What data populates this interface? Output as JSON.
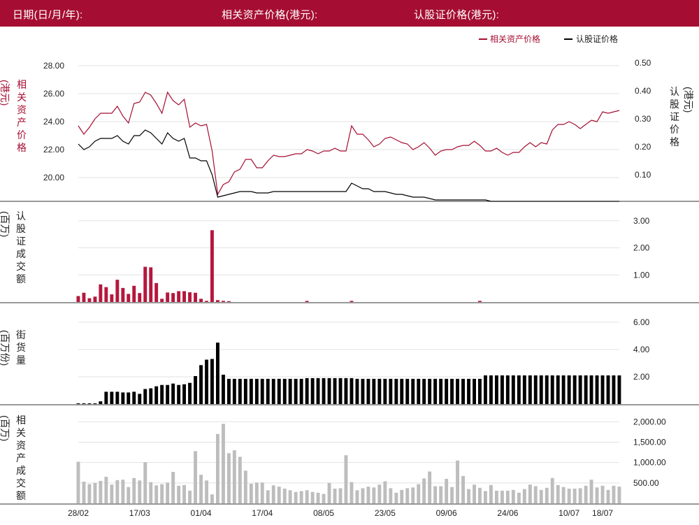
{
  "header": {
    "date_label": "日期(日/月/年):",
    "underlying_label": "相关资产价格(港元):",
    "warrant_label": "认股证价格(港元):"
  },
  "colors": {
    "brand": "#a50e32",
    "underlying": "#a50e32",
    "warrant": "#000000",
    "warrant_volume": "#b5173d",
    "outstanding": "#000000",
    "underlying_turnover": "#bdbdbd",
    "grid": "#e2e2e2"
  },
  "chart_data": [
    {
      "type": "line",
      "panel": "price",
      "legend": [
        "相关资产价格",
        "认股证价格"
      ],
      "legend_position": "top-right",
      "left_axis": {
        "label_chars": [
          "相",
          "关",
          "资",
          "产",
          "价",
          "格"
        ],
        "unit": "(港元)",
        "ticks": [
          "20.00",
          "22.00",
          "24.00",
          "26.00",
          "28.00"
        ],
        "range": [
          18.2,
          28.7
        ]
      },
      "right_axis": {
        "label_chars": [
          "认",
          "股",
          "证",
          "价",
          "格"
        ],
        "unit": "(港元)",
        "ticks": [
          "0.10",
          "0.20",
          "0.30",
          "0.40",
          "0.50"
        ],
        "range": [
          0.0,
          0.525
        ]
      },
      "series": [
        {
          "name": "相关资产价格",
          "axis": "left",
          "values": [
            23.7,
            23.1,
            23.6,
            24.2,
            24.6,
            24.6,
            24.6,
            25.1,
            24.4,
            23.9,
            25.3,
            25.4,
            26.1,
            25.9,
            25.3,
            24.6,
            26.1,
            25.5,
            25.2,
            25.6,
            23.6,
            23.9,
            23.7,
            23.8,
            21.9,
            18.8,
            19.5,
            19.7,
            20.4,
            20.6,
            21.3,
            21.3,
            20.7,
            20.7,
            21.2,
            21.6,
            21.5,
            21.5,
            21.6,
            21.7,
            21.7,
            22.0,
            21.9,
            21.7,
            21.9,
            21.9,
            22.1,
            21.9,
            21.9,
            23.7,
            23.1,
            23.1,
            22.7,
            22.2,
            22.4,
            22.8,
            22.9,
            22.7,
            22.5,
            22.4,
            22.0,
            22.2,
            22.5,
            22.1,
            21.6,
            21.9,
            22.0,
            22.0,
            22.2,
            22.3,
            22.3,
            22.6,
            22.3,
            21.9,
            21.9,
            22.1,
            21.8,
            21.6,
            21.8,
            21.8,
            22.2,
            22.5,
            22.2,
            22.5,
            22.4,
            23.4,
            23.8,
            23.8,
            24.0,
            23.8,
            23.5,
            23.8,
            24.1,
            24.0,
            24.7,
            24.6,
            24.7,
            24.8
          ]
        },
        {
          "name": "认股证价格",
          "axis": "right",
          "values": [
            0.21,
            0.19,
            0.2,
            0.22,
            0.23,
            0.23,
            0.23,
            0.24,
            0.22,
            0.21,
            0.24,
            0.24,
            0.26,
            0.25,
            0.23,
            0.21,
            0.25,
            0.23,
            0.22,
            0.23,
            0.16,
            0.16,
            0.15,
            0.15,
            0.1,
            0.02,
            0.025,
            0.03,
            0.035,
            0.04,
            0.04,
            0.04,
            0.035,
            0.035,
            0.035,
            0.04,
            0.04,
            0.04,
            0.04,
            0.04,
            0.04,
            0.04,
            0.04,
            0.04,
            0.04,
            0.04,
            0.04,
            0.04,
            0.04,
            0.07,
            0.06,
            0.05,
            0.05,
            0.04,
            0.04,
            0.04,
            0.035,
            0.03,
            0.03,
            0.025,
            0.02,
            0.02,
            0.02,
            0.015,
            0.01,
            0.01,
            0.01,
            0.01,
            0.01,
            0.01,
            0.01,
            0.01,
            0.01,
            0.01,
            0.005,
            0.005,
            0.005,
            0.005,
            0.005,
            0.005,
            0.005,
            0.005,
            0.005,
            0.005,
            0.005,
            0.005,
            0.005,
            0.005,
            0.005,
            0.005,
            0.005,
            0.005,
            0.005,
            0.005,
            0.005,
            0.005,
            0.005,
            0.005
          ]
        }
      ]
    },
    {
      "type": "bar",
      "panel": "warrant_turnover",
      "axis_label_chars": [
        "认",
        "股",
        "证",
        "成",
        "交",
        "额"
      ],
      "unit": "(百万)",
      "ticks": [
        "1.00",
        "2.00",
        "3.00"
      ],
      "range": [
        0,
        3.2
      ],
      "values": [
        0.22,
        0.34,
        0.14,
        0.2,
        0.65,
        0.55,
        0.28,
        0.82,
        0.52,
        0.3,
        0.6,
        0.33,
        1.3,
        1.28,
        0.7,
        0.12,
        0.35,
        0.33,
        0.4,
        0.4,
        0.36,
        0.34,
        0.12,
        0.04,
        2.65,
        0.07,
        0.04,
        0.03,
        0,
        0,
        0,
        0,
        0,
        0,
        0,
        0,
        0,
        0,
        0,
        0,
        0,
        0.04,
        0,
        0,
        0,
        0,
        0,
        0,
        0,
        0.04,
        0,
        0,
        0,
        0,
        0,
        0,
        0,
        0,
        0,
        0,
        0,
        0,
        0,
        0,
        0,
        0,
        0,
        0,
        0,
        0,
        0,
        0,
        0.04,
        0,
        0,
        0,
        0,
        0,
        0,
        0,
        0,
        0,
        0,
        0,
        0,
        0,
        0,
        0,
        0,
        0,
        0,
        0,
        0,
        0,
        0,
        0,
        0,
        0
      ]
    },
    {
      "type": "bar",
      "panel": "outstanding",
      "axis_label_chars": [
        "街",
        "货",
        "量"
      ],
      "unit": "(百万份)",
      "ticks": [
        "2.00",
        "4.00",
        "6.00"
      ],
      "range": [
        0,
        6.4
      ],
      "values": [
        0.05,
        0.05,
        0.05,
        0.05,
        0.2,
        0.9,
        0.9,
        0.9,
        0.85,
        0.85,
        0.9,
        0.75,
        1.1,
        1.15,
        1.3,
        1.4,
        1.4,
        1.5,
        1.4,
        1.45,
        1.55,
        2.05,
        2.85,
        3.25,
        3.3,
        4.5,
        2.15,
        1.85,
        1.85,
        1.85,
        1.85,
        1.85,
        1.85,
        1.85,
        1.85,
        1.85,
        1.85,
        1.85,
        1.85,
        1.85,
        1.85,
        1.9,
        1.9,
        1.9,
        1.9,
        1.9,
        1.9,
        1.9,
        1.9,
        1.9,
        1.85,
        1.85,
        1.85,
        1.85,
        1.85,
        1.85,
        1.85,
        1.85,
        1.85,
        1.85,
        1.85,
        1.85,
        1.85,
        1.85,
        1.85,
        1.85,
        1.85,
        1.85,
        1.85,
        1.85,
        1.85,
        1.85,
        1.85,
        2.1,
        2.1,
        2.1,
        2.1,
        2.1,
        2.1,
        2.1,
        2.1,
        2.1,
        2.1,
        2.1,
        2.1,
        2.1,
        2.1,
        2.1,
        2.1,
        2.1,
        2.1,
        2.1,
        2.1,
        2.1,
        2.1,
        2.1,
        2.1,
        2.1
      ]
    },
    {
      "type": "bar",
      "panel": "underlying_turnover",
      "axis_label_chars": [
        "相",
        "关",
        "资",
        "产",
        "成",
        "交",
        "额"
      ],
      "unit": "(百万)",
      "ticks": [
        "500.00",
        "1,000.00",
        "1,500.00",
        "2,000.00"
      ],
      "range": [
        0,
        2160
      ],
      "values": [
        1020,
        530,
        470,
        500,
        550,
        650,
        460,
        570,
        580,
        400,
        620,
        560,
        1010,
        520,
        440,
        470,
        510,
        770,
        430,
        450,
        310,
        1280,
        700,
        560,
        220,
        1700,
        1950,
        1230,
        1300,
        1140,
        800,
        480,
        510,
        510,
        320,
        440,
        410,
        360,
        320,
        280,
        300,
        320,
        280,
        260,
        230,
        500,
        360,
        370,
        1180,
        520,
        320,
        370,
        410,
        390,
        460,
        540,
        370,
        260,
        330,
        370,
        390,
        470,
        610,
        780,
        420,
        420,
        600,
        400,
        1050,
        670,
        350,
        460,
        380,
        300,
        450,
        310,
        310,
        310,
        330,
        260,
        350,
        460,
        420,
        330,
        380,
        620,
        450,
        400,
        360,
        360,
        370,
        430,
        580,
        390,
        430,
        330,
        430,
        410
      ]
    }
  ],
  "x_axis": {
    "ticks": [
      {
        "label": "28/02",
        "index": 0
      },
      {
        "label": "17/03",
        "index": 11
      },
      {
        "label": "01/04",
        "index": 22
      },
      {
        "label": "17/04",
        "index": 33
      },
      {
        "label": "08/05",
        "index": 44
      },
      {
        "label": "23/05",
        "index": 55
      },
      {
        "label": "09/06",
        "index": 66
      },
      {
        "label": "24/06",
        "index": 77
      },
      {
        "label": "10/07",
        "index": 88
      },
      {
        "label": "18/07",
        "index": 94
      }
    ]
  }
}
